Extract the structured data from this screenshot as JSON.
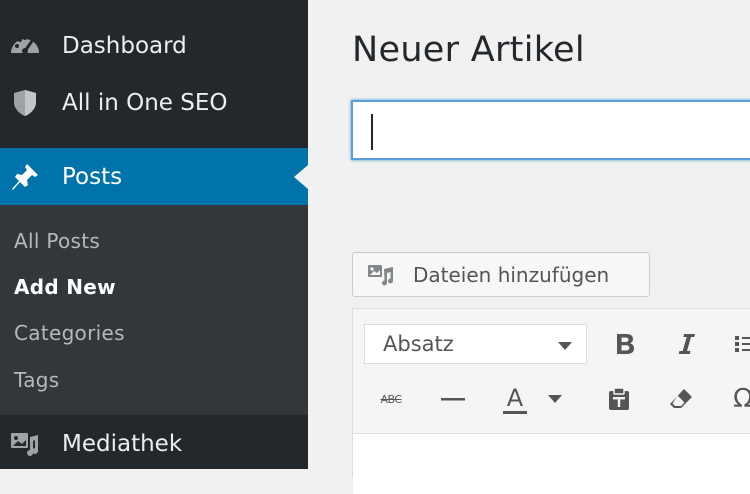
{
  "sidebar": {
    "items": [
      {
        "label": "Dashboard",
        "icon": "dashboard-icon"
      },
      {
        "label": "All in One SEO",
        "icon": "shield-icon"
      },
      {
        "label": "Posts",
        "icon": "pin-icon"
      },
      {
        "label": "Mediathek",
        "icon": "media-icon"
      }
    ],
    "posts_submenu": [
      {
        "label": "All Posts"
      },
      {
        "label": "Add New"
      },
      {
        "label": "Categories"
      },
      {
        "label": "Tags"
      }
    ],
    "active_color": "#0073aa",
    "background_color": "#23282d"
  },
  "main": {
    "page_title": "Neuer Artikel",
    "title_input_value": "",
    "add_media_label": "Dateien hinzufügen",
    "editor": {
      "format_select_value": "Absatz",
      "toolbar_row1": [
        "bold-icon",
        "italic-icon",
        "bullet-list-icon"
      ],
      "toolbar_row2": [
        "strikethrough-icon",
        "horizontal-line-icon",
        "text-color-icon",
        "paste-as-text-icon",
        "clear-formatting-icon",
        "special-character-icon"
      ],
      "strikethrough_glyph": "ABC",
      "text_color_glyph": "A",
      "omega_glyph": "Ω"
    }
  }
}
